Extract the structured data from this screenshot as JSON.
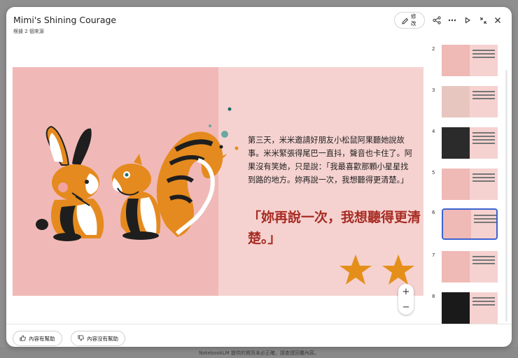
{
  "header": {
    "title": "Mimi's Shining Courage",
    "subtitle": "根據 2 個來源",
    "edit_label": "修改"
  },
  "toolbar_icons": [
    "pencil-icon",
    "share-icon",
    "more-icon",
    "play-icon",
    "collapse-icon",
    "close-icon"
  ],
  "slide": {
    "body": "第三天，米米邀請好朋友小松鼠阿果聽她說故事。米米緊張得尾巴一直抖，聲音也卡住了。阿果沒有笑她，只是說：「我最喜歡那顆小星星找到路的地方。妳再說一次，我想聽得更清楚。」",
    "quote": "「妳再說一次，我想聽得更清楚。」",
    "stars": 2,
    "colors": {
      "quote": "#a72b22",
      "star": "#e58f1b",
      "left_bg": "#f0b9b7",
      "right_bg": "#f5d2d0"
    }
  },
  "zoom": {
    "in": "+",
    "out": "−"
  },
  "thumbnails": [
    {
      "number": "2"
    },
    {
      "number": "3"
    },
    {
      "number": "4"
    },
    {
      "number": "5"
    },
    {
      "number": "6",
      "selected": true
    },
    {
      "number": "7"
    },
    {
      "number": "8"
    }
  ],
  "feedback": {
    "helpful": "內容有幫助",
    "not_helpful": "內容沒有幫助"
  },
  "footer_caption": "NotebookLM 提供的資訊未必正確，請查證回覆內容。"
}
